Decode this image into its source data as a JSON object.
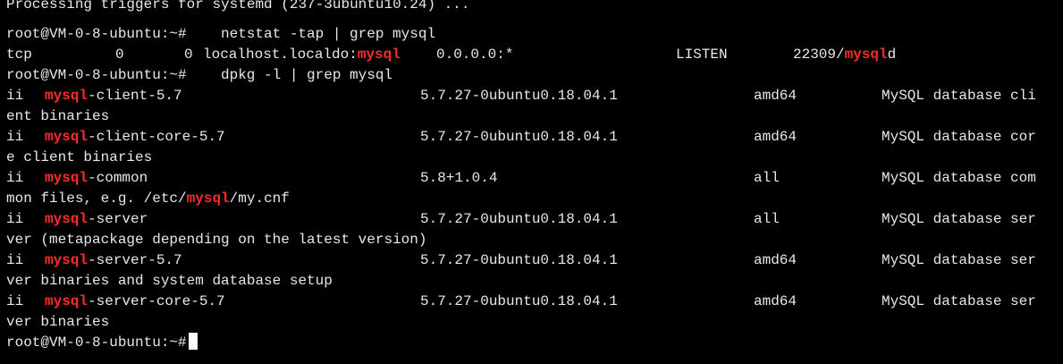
{
  "terminal": {
    "background": "#000000",
    "foreground": "#e8e8e8",
    "highlight_color": "#ff2b2b",
    "cursor_color": "#ffffff",
    "top_partial": "Processing triggers for systemd (237-3ubuntu10.24) ...",
    "prompt": "root@VM-0-8-ubuntu:~#",
    "cmd_netstat": "netstat -tap | grep mysql",
    "netstat_row": {
      "proto": "tcp",
      "recvq": "0",
      "sendq": "0",
      "local_prefix": "localhost.localdo:",
      "local_hl": "mysql",
      "foreign": "0.0.0.0:*",
      "state": "LISTEN",
      "pid_prefix": "22309/",
      "pid_hl": "mysql",
      "pid_suffix": "d"
    },
    "cmd_dpkg": "dpkg -l | grep mysql",
    "packages": [
      {
        "status": "ii",
        "name_hl": "mysql",
        "name_rest": "-client-5.7",
        "version": "5.7.27-0ubuntu0.18.04.1",
        "arch": "amd64",
        "desc_first": "MySQL database cli",
        "desc_wrap": "ent binaries"
      },
      {
        "status": "ii",
        "name_hl": "mysql",
        "name_rest": "-client-core-5.7",
        "version": "5.7.27-0ubuntu0.18.04.1",
        "arch": "amd64",
        "desc_first": "MySQL database cor",
        "desc_wrap": "e client binaries"
      },
      {
        "status": "ii",
        "name_hl": "mysql",
        "name_rest": "-common",
        "version": "5.8+1.0.4",
        "arch": "all",
        "desc_first": "MySQL database com",
        "desc_wrap_prefix": "mon files, e.g. /etc/",
        "desc_wrap_hl": "mysql",
        "desc_wrap_suffix": "/my.cnf"
      },
      {
        "status": "ii",
        "name_hl": "mysql",
        "name_rest": "-server",
        "version": "5.7.27-0ubuntu0.18.04.1",
        "arch": "all",
        "desc_first": "MySQL database ser",
        "desc_wrap": "ver (metapackage depending on the latest version)"
      },
      {
        "status": "ii",
        "name_hl": "mysql",
        "name_rest": "-server-5.7",
        "version": "5.7.27-0ubuntu0.18.04.1",
        "arch": "amd64",
        "desc_first": "MySQL database ser",
        "desc_wrap": "ver binaries and system database setup"
      },
      {
        "status": "ii",
        "name_hl": "mysql",
        "name_rest": "-server-core-5.7",
        "version": "5.7.27-0ubuntu0.18.04.1",
        "arch": "amd64",
        "desc_first": "MySQL database ser",
        "desc_wrap": "ver binaries"
      }
    ]
  }
}
